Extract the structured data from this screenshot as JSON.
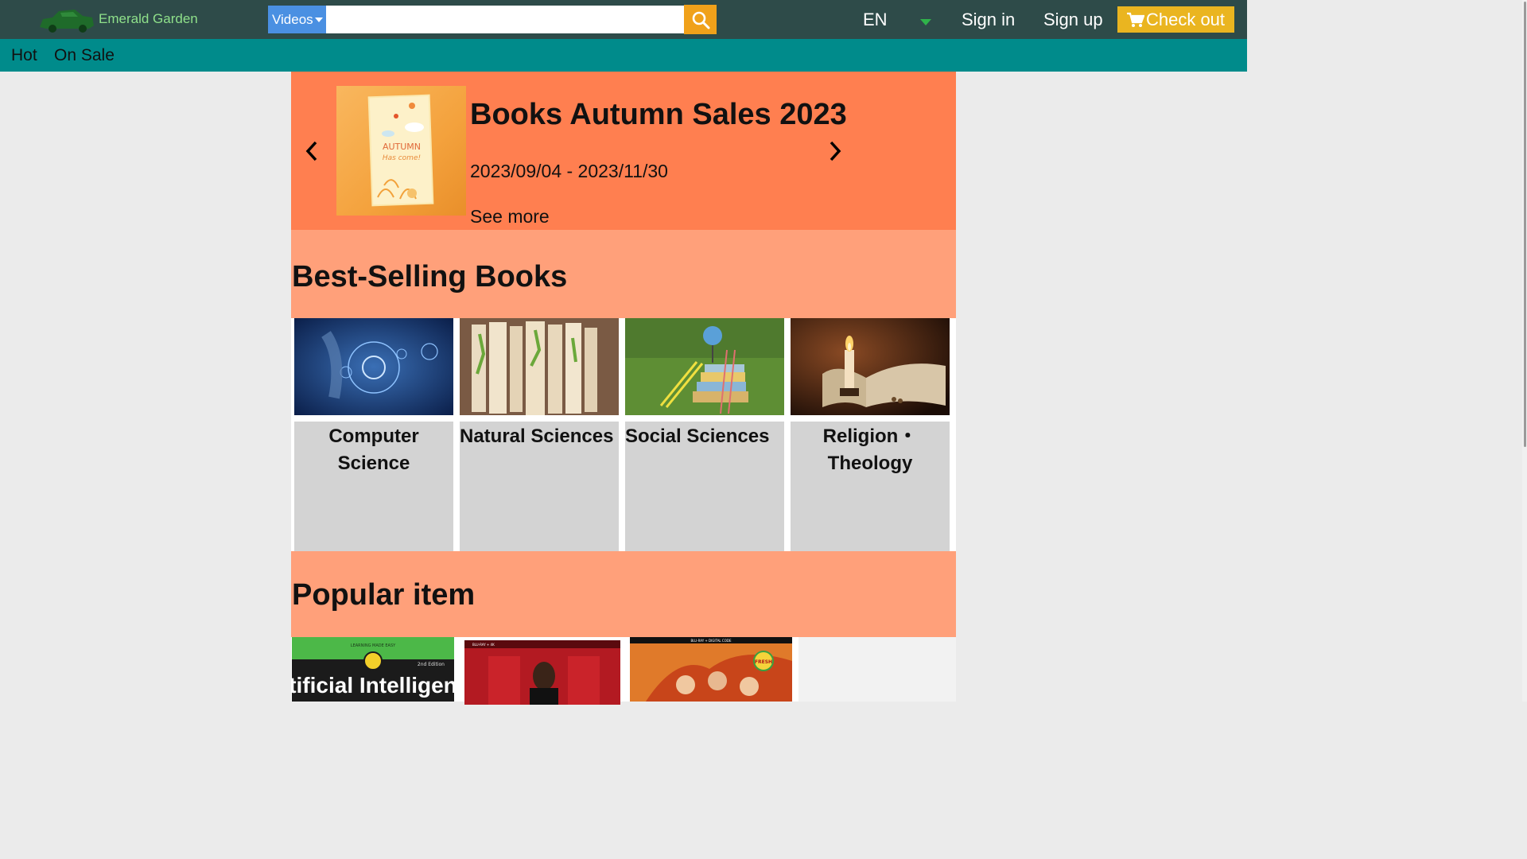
{
  "header": {
    "logo_text": "Emerald Garden",
    "logo_icon": "car-logo-icon",
    "search_category": "Videos",
    "search_placeholder": "",
    "search_icon": "search-icon",
    "language": "EN",
    "sign_in": "Sign in",
    "sign_up": "Sign up",
    "checkout": "Check out",
    "cart_icon": "cart-icon"
  },
  "nav": {
    "items": [
      {
        "label": "Hot"
      },
      {
        "label": "On Sale"
      }
    ]
  },
  "banner": {
    "title": "Books Autumn Sales 2023",
    "date_range": "2023/09/04 - 2023/11/30",
    "see_more": "See more",
    "book_text_line1": "AUTUMN",
    "book_text_line2": "Has come!"
  },
  "best_selling": {
    "heading": "Best-Selling Books",
    "categories": [
      {
        "label": "Computer Science"
      },
      {
        "label": "Natural Sciences"
      },
      {
        "label": "Social Sciences"
      },
      {
        "label": "Religion・Theology"
      }
    ]
  },
  "popular": {
    "heading": "Popular item",
    "items": [
      {
        "cover_top": "LEARNING MADE EASY",
        "cover_edition": "2nd Edition",
        "cover_title": "Artificial Intelligence"
      },
      {
        "cover_top": "BLU-RAY + 4K"
      },
      {
        "cover_top": "BLU-RAY + DIGITAL CODE",
        "badge": "FRESH"
      }
    ]
  },
  "colors": {
    "topbar": "#2e4b49",
    "navbar": "#008b8b",
    "banner": "#ff7f50",
    "section_head": "#ffa07a",
    "checkout": "#eab520",
    "search_button": "#f0a11a",
    "search_select": "#4a90e2"
  }
}
